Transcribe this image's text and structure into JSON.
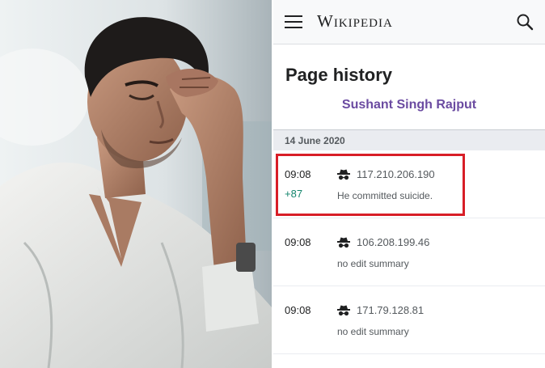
{
  "photo": {
    "subject": "man-resting-head-on-hand"
  },
  "header": {
    "menu_icon": "hamburger-menu-icon",
    "wordmark": "Wikipedia",
    "search_icon": "magnifier-search-icon"
  },
  "page": {
    "title": "Page history",
    "article": "Sushant Singh Rajput"
  },
  "history": {
    "date": "14 June 2020",
    "revisions": [
      {
        "time": "09:08",
        "bytes": "+87",
        "user_icon": "anonymous-user-icon",
        "ip": "117.210.206.190",
        "summary": "He committed suicide.",
        "highlighted": true
      },
      {
        "time": "09:08",
        "bytes": "",
        "user_icon": "anonymous-user-icon",
        "ip": "106.208.199.46",
        "summary": "no edit summary",
        "highlighted": false
      },
      {
        "time": "09:08",
        "bytes": "",
        "user_icon": "anonymous-user-icon",
        "ip": "171.79.128.81",
        "summary": "no edit summary",
        "highlighted": false
      }
    ]
  },
  "colors": {
    "link": "#6b4ba1",
    "bytes_added": "#14866d",
    "highlight": "#d81e27",
    "header_bg": "#f8f9fa",
    "date_bg": "#eaecf0"
  }
}
